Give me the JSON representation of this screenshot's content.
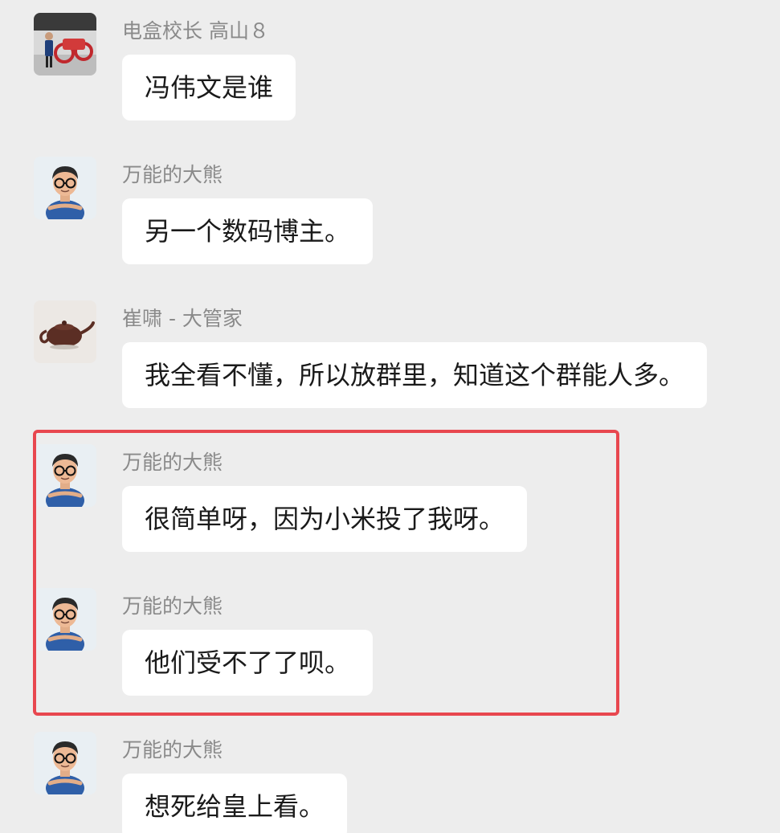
{
  "messages": [
    {
      "sender": "电盒校长 高山８",
      "text": "冯伟文是谁",
      "avatar": "person-with-motorcycle-photo"
    },
    {
      "sender": "万能的大熊",
      "text": "另一个数码博主。",
      "avatar": "cartoon-glasses-man"
    },
    {
      "sender": "崔啸 - 大管家",
      "text": "我全看不懂，所以放群里，知道这个群能人多。",
      "avatar": "teapot-photo"
    },
    {
      "sender": "万能的大熊",
      "text": "很简单呀，因为小米投了我呀。",
      "avatar": "cartoon-glasses-man"
    },
    {
      "sender": "万能的大熊",
      "text": "他们受不了了呗。",
      "avatar": "cartoon-glasses-man"
    },
    {
      "sender": "万能的大熊",
      "text": "想死给皇上看。",
      "avatar": "cartoon-glasses-man"
    }
  ],
  "colors": {
    "background": "#ededed",
    "bubble": "#ffffff",
    "highlight_border": "#e8474f",
    "sender_text": "#8a8a8a"
  }
}
